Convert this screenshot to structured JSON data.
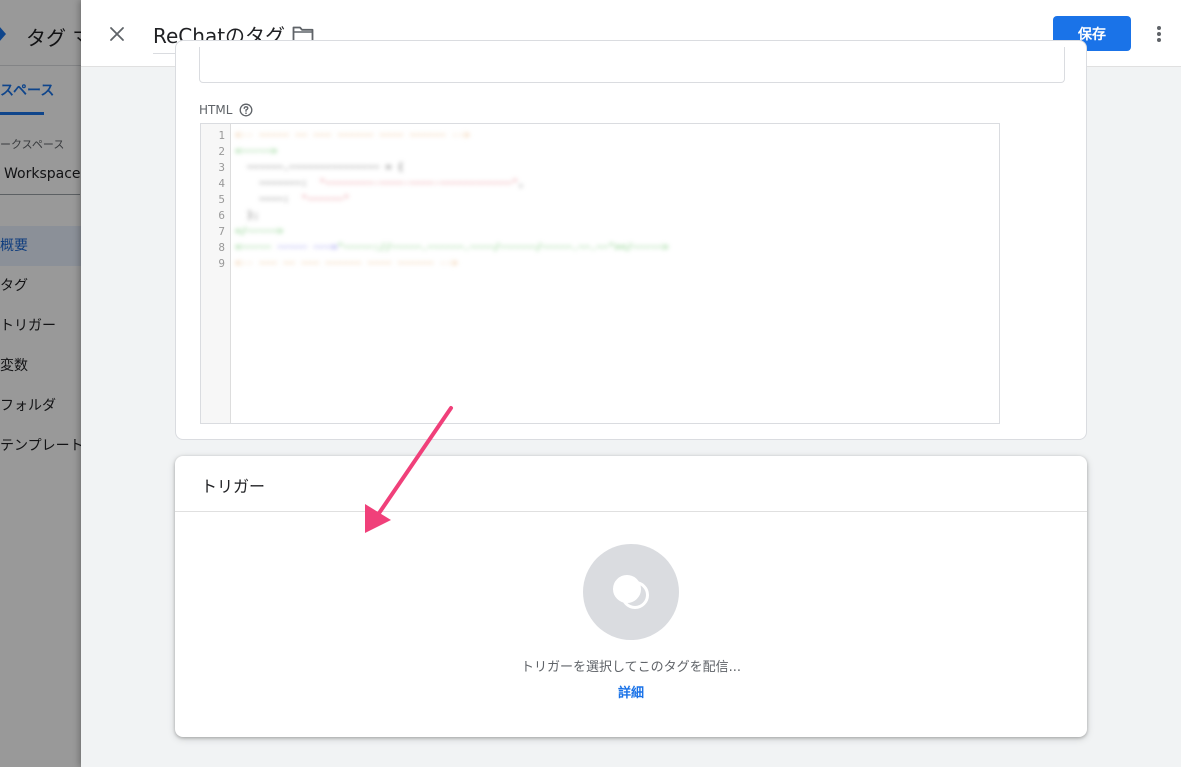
{
  "background": {
    "app_title": "タグ マ",
    "tab_label": "スペース",
    "workspace_label": "ークスペース",
    "workspace_name": "Workspace",
    "nav_items": [
      {
        "label": "概要",
        "active": true
      },
      {
        "label": "タグ",
        "active": false
      },
      {
        "label": "トリガー",
        "active": false
      },
      {
        "label": "変数",
        "active": false
      },
      {
        "label": "フォルダ",
        "active": false
      },
      {
        "label": "テンプレート",
        "active": false
      }
    ]
  },
  "header": {
    "tag_name": "ReChatのタグ",
    "save_label": "保存",
    "icons": [
      "close-icon",
      "folder-icon",
      "more-vert-icon"
    ]
  },
  "config": {
    "html_label": "HTML",
    "line_numbers": [
      "1",
      "2",
      "3",
      "4",
      "5",
      "6",
      "7",
      "8",
      "9"
    ]
  },
  "trigger": {
    "title": "トリガー",
    "prompt": "トリガーを選択してこのタグを配信...",
    "detail_link": "詳細"
  },
  "colors": {
    "accent": "#1a73e8",
    "annotation_arrow": "#f0407a"
  }
}
